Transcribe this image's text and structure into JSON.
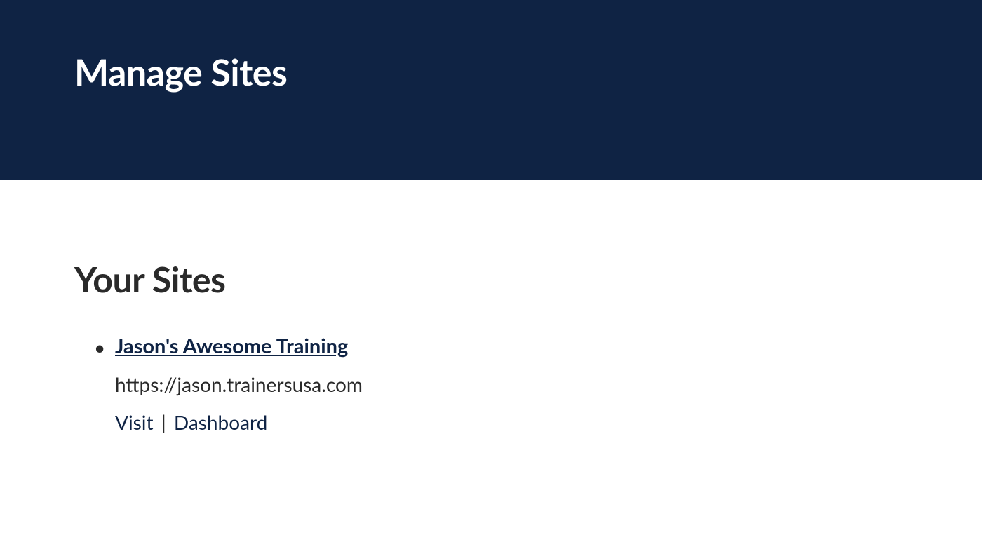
{
  "header": {
    "title": "Manage Sites"
  },
  "main": {
    "section_title": "Your Sites",
    "sites": [
      {
        "name": "Jason's Awesome Training",
        "url": "https://jason.trainersusa.com",
        "visit_label": "Visit",
        "dashboard_label": "Dashboard"
      }
    ],
    "action_separator": " | "
  }
}
